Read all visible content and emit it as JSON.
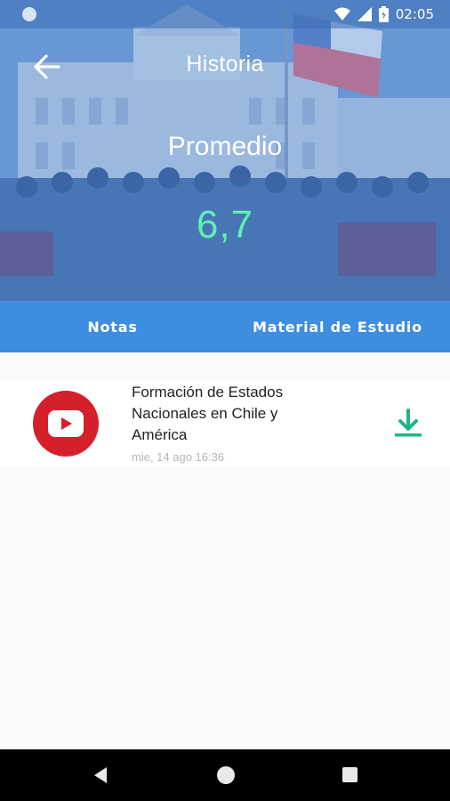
{
  "status_bar": {
    "time": "02:05"
  },
  "header": {
    "title": "Historia",
    "average_label": "Promedio",
    "average_value": "6,7"
  },
  "tabs": [
    {
      "label": "Notas",
      "active": false
    },
    {
      "label": "Material de Estudio",
      "active": true
    }
  ],
  "materials": [
    {
      "icon": "youtube-icon",
      "title": "Formación de Estados Nacionales en Chile y América",
      "date": "mie, 14 ago 16:36",
      "action_icon": "download-icon"
    }
  ],
  "colors": {
    "tab_bar": "#3f8de0",
    "average_value": "#5ef0b2",
    "youtube_red": "#d51f2b",
    "download_green": "#20b48a"
  }
}
